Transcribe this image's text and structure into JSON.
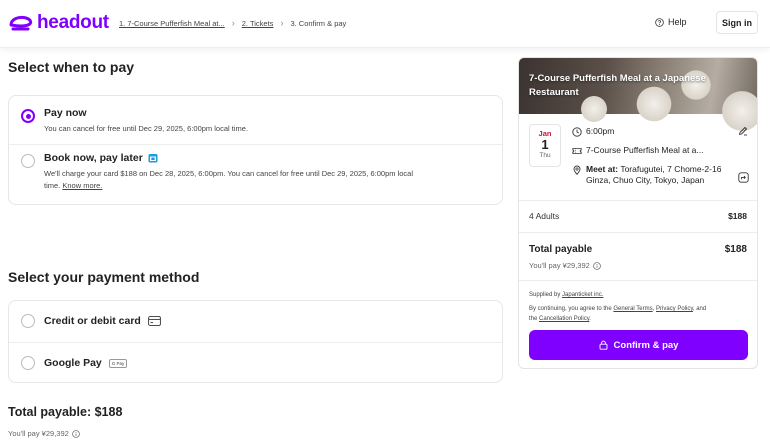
{
  "brand": {
    "name": "headout",
    "accent": "#8000ff"
  },
  "breadcrumb": {
    "step1": "1. 7-Course Pufferfish Meal at...",
    "step2": "2. Tickets",
    "step3": "3. Confirm & pay"
  },
  "header": {
    "help": "Help",
    "signin": "Sign in"
  },
  "when_to_pay": {
    "title": "Select when to pay",
    "pay_now": {
      "label": "Pay now",
      "sub": "You can cancel for free until Dec 29, 2025, 6:00pm local time."
    },
    "pay_later": {
      "label": "Book now, pay later",
      "sub": "We'll charge your card $188 on Dec 28, 2025, 6:00pm. You can cancel for free until Dec 29, 2025, 6:00pm local",
      "sub2": "time.",
      "know_more": "Know more."
    }
  },
  "payment_method": {
    "title": "Select your payment method",
    "credit": "Credit or debit card",
    "gpay": "Google Pay",
    "gpay_badge": "G Pay"
  },
  "summary": {
    "total_label": "Total payable: $188",
    "you_pay": "You'll pay ¥29,392"
  },
  "card": {
    "title": "7-Course Pufferfish Meal at a Japanese Restaurant",
    "month": "Jan",
    "day": "1",
    "dow": "Thu",
    "time": "6:00pm",
    "product": "7-Course Pufferfish Meal at a...",
    "meet_label": "Meet at:",
    "meet_addr": " Torafugutei, 7 Chome-2-16",
    "meet_addr2": "Ginza, Chuo City, Tokyo, Japan",
    "adults": "4 Adults",
    "adults_price": "$188",
    "total_label": "Total payable",
    "total_value": "$188",
    "you_pay": "You'll pay ¥29,392",
    "supplied_prefix": "Supplied by ",
    "supplier": "Japanticket inc.",
    "terms_prefix": "By continuing, you agree to the ",
    "general_terms": "General Terms",
    "comma": ", ",
    "privacy": "Privacy Policy",
    "and": ", and",
    "the": "the ",
    "cancellation": "Cancellation Policy",
    "period": ".",
    "confirm": "Confirm & pay"
  }
}
